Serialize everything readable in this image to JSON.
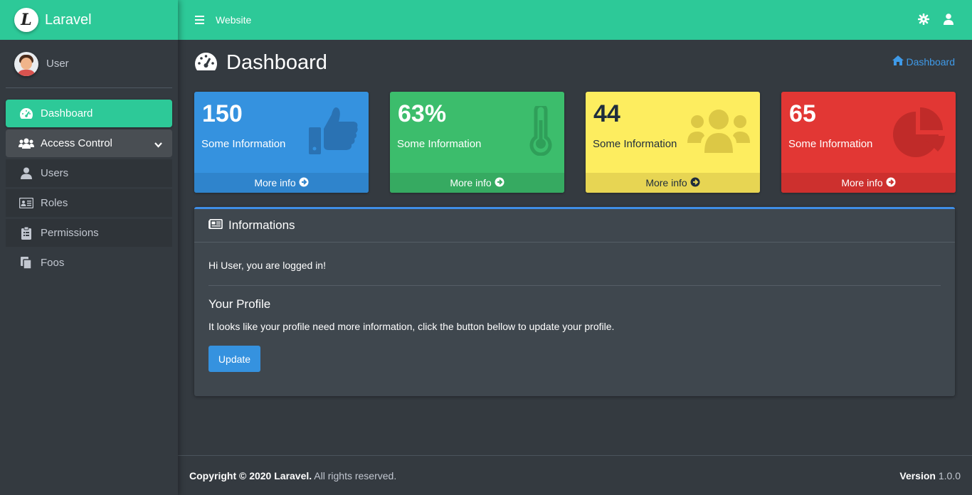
{
  "brand": {
    "letter": "L",
    "name": "Laravel"
  },
  "user": {
    "name": "User"
  },
  "sidebar": {
    "items": [
      {
        "label": "Dashboard",
        "icon": "tachometer-icon",
        "state": "active"
      },
      {
        "label": "Access Control",
        "icon": "users-icon",
        "state": "open"
      },
      {
        "label": "Users",
        "icon": "user-icon",
        "state": "sub"
      },
      {
        "label": "Roles",
        "icon": "id-card-icon",
        "state": "sub"
      },
      {
        "label": "Permissions",
        "icon": "clipboard-icon",
        "state": "sub"
      },
      {
        "label": "Foos",
        "icon": "copy-icon",
        "state": "normal"
      }
    ]
  },
  "topbar": {
    "link": "Website",
    "icons": [
      "settings-icon",
      "user-icon"
    ]
  },
  "page": {
    "title": "Dashboard",
    "breadcrumb": "Dashboard"
  },
  "boxes": [
    {
      "value": "150",
      "label": "Some Information",
      "more": "More info",
      "color": "#3592df",
      "icon": "thumbs-up-icon"
    },
    {
      "value": "63%",
      "label": "Some Information",
      "more": "More info",
      "color": "#3cbd6c",
      "icon": "thermometer-icon"
    },
    {
      "value": "44",
      "label": "Some Information",
      "more": "More info",
      "color": "#fded5f",
      "icon": "users-icon"
    },
    {
      "value": "65",
      "label": "Some Information",
      "more": "More info",
      "color": "#e23734",
      "icon": "pie-chart-icon"
    }
  ],
  "card": {
    "title": "Informations",
    "greeting": "Hi User, you are logged in!",
    "profile_heading": "Your Profile",
    "profile_text": "It looks like your profile need more information, click the button bellow to update your profile.",
    "button": "Update"
  },
  "footer": {
    "copyright": "Copyright © 2020 Laravel.",
    "rights": " All rights reserved.",
    "version_label": "Version",
    "version": " 1.0.0"
  },
  "colors": {
    "accent": "#2dc998",
    "sidebar": "#343a40",
    "link": "#3f9ae8"
  }
}
